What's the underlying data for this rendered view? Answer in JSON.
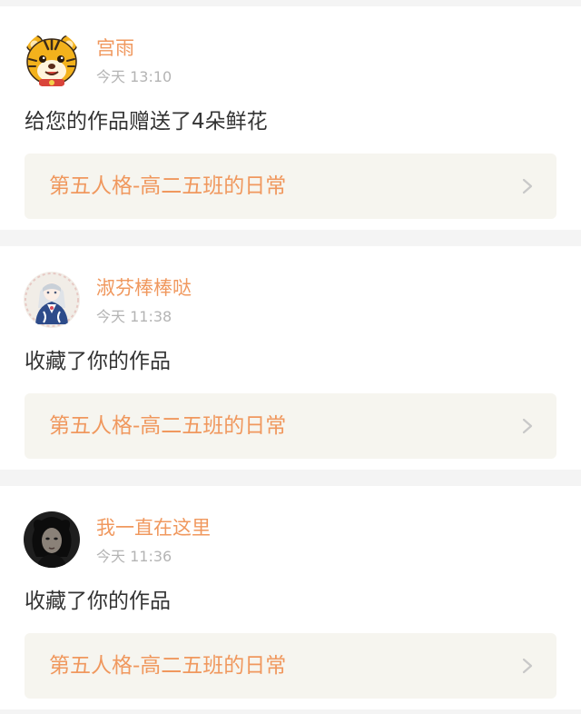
{
  "colors": {
    "accent": "#f0985e",
    "page_background": "#f4f4f4",
    "card_background": "#ffffff",
    "link_box_background": "#f6f5ef",
    "text_primary": "#333333",
    "text_secondary": "#b4b4b4"
  },
  "notifications": [
    {
      "user": "宫雨",
      "time": "今天 13:10",
      "message": "给您的作品赠送了4朵鲜花",
      "work_title": "第五人格-高二五班的日常",
      "avatar_icon": "tiger-avatar-icon",
      "chevron_icon": "chevron-right-icon"
    },
    {
      "user": "淑芬棒棒哒",
      "time": "今天 11:38",
      "message": "收藏了你的作品",
      "work_title": "第五人格-高二五班的日常",
      "avatar_icon": "anime-girl-avatar-icon",
      "chevron_icon": "chevron-right-icon"
    },
    {
      "user": "我一直在这里",
      "time": "今天 11:36",
      "message": "收藏了你的作品",
      "work_title": "第五人格-高二五班的日常",
      "avatar_icon": "dark-portrait-avatar-icon",
      "chevron_icon": "chevron-right-icon"
    }
  ]
}
